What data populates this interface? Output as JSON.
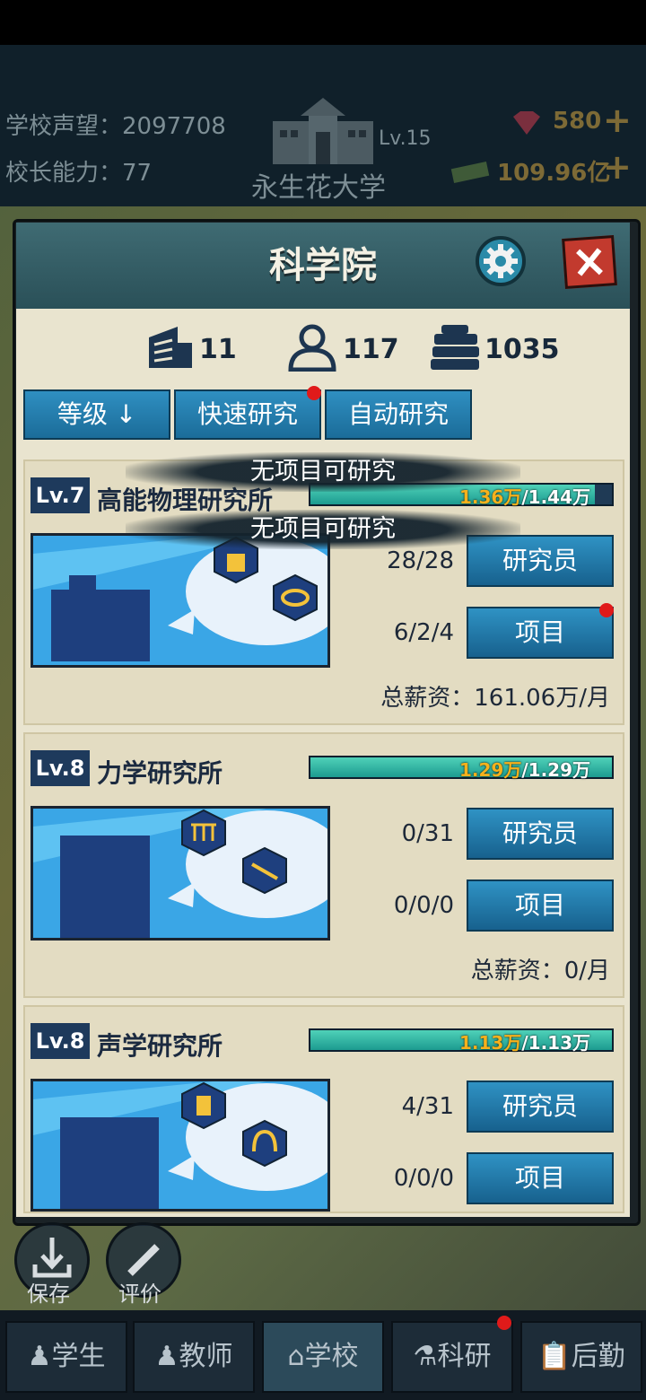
{
  "header": {
    "reputation_label": "学校声望：2097708",
    "ability_label": "校长能力：77",
    "school_level": "Lv.15",
    "school_name": "永生花大学",
    "gems": "580",
    "money": "109.96亿",
    "plus": "+"
  },
  "panel": {
    "title": "科学院",
    "stats": {
      "buildings": "11",
      "researchers": "117",
      "books": "1035"
    },
    "filters": {
      "level": "等级 ↓",
      "quick": "快速研究",
      "auto": "自动研究"
    },
    "toast": "无项目可研究",
    "institutes": [
      {
        "level": "Lv.7",
        "name": "高能物理研究所",
        "progress": 0.944,
        "progress_current": "1.36万",
        "progress_max": "/1.44万",
        "researcher_count": "28/28",
        "researcher_btn": "研究员",
        "project_count": "6/2/4",
        "project_btn": "项目",
        "salary": "总薪资：161.06万/月"
      },
      {
        "level": "Lv.8",
        "name": "力学研究所",
        "progress": 1.0,
        "progress_current": "1.29万",
        "progress_max": "/1.29万",
        "researcher_count": "0/31",
        "researcher_btn": "研究员",
        "project_count": "0/0/0",
        "project_btn": "项目",
        "salary": "总薪资：0/月"
      },
      {
        "level": "Lv.8",
        "name": "声学研究所",
        "progress": 1.0,
        "progress_current": "1.13万",
        "progress_max": "/1.13万",
        "researcher_count": "4/31",
        "researcher_btn": "研究员",
        "project_count": "0/0/0",
        "project_btn": "项目"
      }
    ]
  },
  "bottom_actions": {
    "save": "保存",
    "review": "评价"
  },
  "nav": {
    "students": "学生",
    "teachers": "教师",
    "school": "学校",
    "research": "科研",
    "logistics": "后勤"
  },
  "colors": {
    "accent": "#2f8fc1",
    "panel_bg": "#e9e4cf",
    "progress_current": "#f6b11c"
  }
}
